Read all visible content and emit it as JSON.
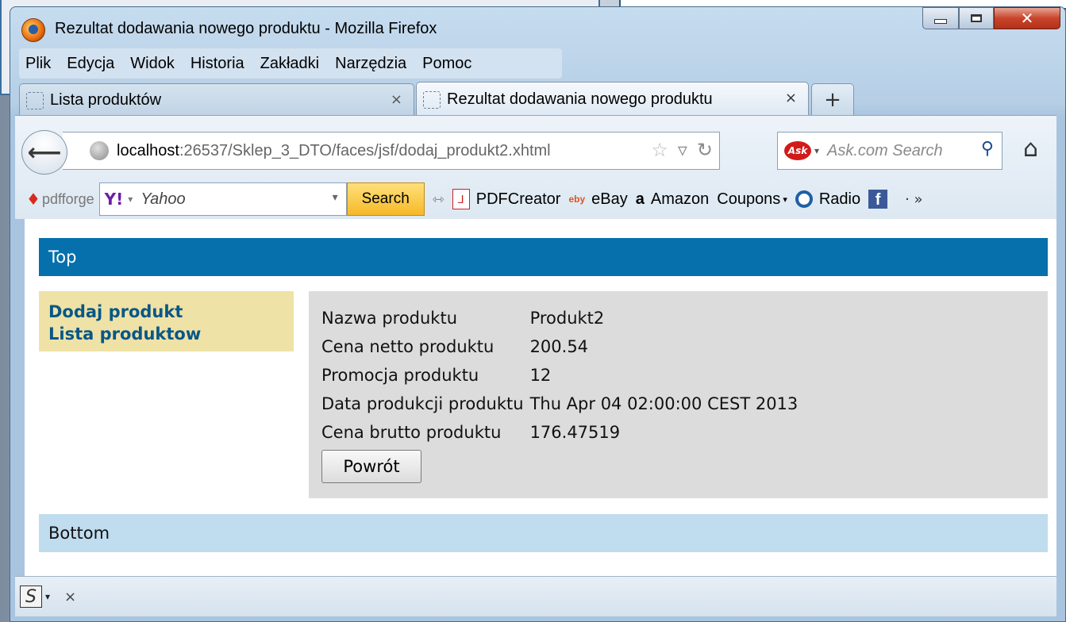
{
  "window": {
    "title": "Rezultat dodawania nowego produktu - Mozilla Firefox",
    "close_glyph": "✕"
  },
  "menu": {
    "items": [
      "Plik",
      "Edycja",
      "Widok",
      "Historia",
      "Zakładki",
      "Narzędzia",
      "Pomoc"
    ]
  },
  "tabs": [
    {
      "label": "Lista produktów",
      "active": false
    },
    {
      "label": "Rezultat dodawania nowego produktu",
      "active": true
    }
  ],
  "tab_close_glyph": "×",
  "new_tab_glyph": "+",
  "navigation": {
    "back_glyph": "⟵",
    "url_host": "localhost",
    "url_rest": ":26537/Sklep_3_DTO/faces/jsf/dodaj_produkt2.xhtml",
    "star_glyph": "☆",
    "dropdown_glyph": "▿",
    "reload_glyph": "↻",
    "home_glyph": "⌂"
  },
  "search": {
    "engine_logo": "Ask",
    "placeholder": "Ask.com Search",
    "caret": "▾",
    "button_glyph": "⚲"
  },
  "toolbar2": {
    "pdfforge_label": "pdfforge",
    "pdfforge_glyph": "♦",
    "yahoo_logo": "Y!",
    "yahoo_caret": "▾",
    "yahoo_placeholder": "Yahoo",
    "yahoo_dropdown": "▾",
    "search_button": "Search",
    "grip_glyph": "⇿",
    "bookmarks": [
      {
        "label": "PDFCreator",
        "icon": "pdf-icon",
        "glyph": "⅃"
      },
      {
        "label": "eBay",
        "icon": "ebay-icon",
        "glyph": "eby"
      },
      {
        "label": "Amazon",
        "icon": "amazon-icon",
        "glyph": "a"
      },
      {
        "label": "Coupons",
        "icon": "",
        "glyph": ""
      },
      {
        "label": "Radio",
        "icon": "radio-icon",
        "glyph": ""
      },
      {
        "label": "",
        "icon": "facebook-icon",
        "glyph": "f"
      }
    ],
    "coupons_caret": "▾",
    "more_glyph": "· »"
  },
  "page": {
    "top_label": "Top",
    "left_menu": [
      "Dodaj produkt",
      "Lista produktow"
    ],
    "rows": [
      {
        "label": "Nazwa produktu",
        "value": "Produkt2"
      },
      {
        "label": "Cena netto produktu",
        "value": "200.54"
      },
      {
        "label": "Promocja produktu",
        "value": "12"
      },
      {
        "label": "Data produkcji produktu",
        "value": "Thu Apr 04 02:00:00 CEST 2013"
      },
      {
        "label": "Cena brutto produktu",
        "value": "176.47519"
      }
    ],
    "back_button": "Powrót",
    "bottom_label": "Bottom"
  },
  "statusbar": {
    "icon_glyph": "S",
    "caret": "▾",
    "close_glyph": "×"
  },
  "colors": {
    "top_band": "#0570ab",
    "left_menu_bg": "#efe2a6",
    "link_color": "#075788",
    "panel_bg": "#dcdcdc",
    "bottom_band": "#c0dcef"
  }
}
